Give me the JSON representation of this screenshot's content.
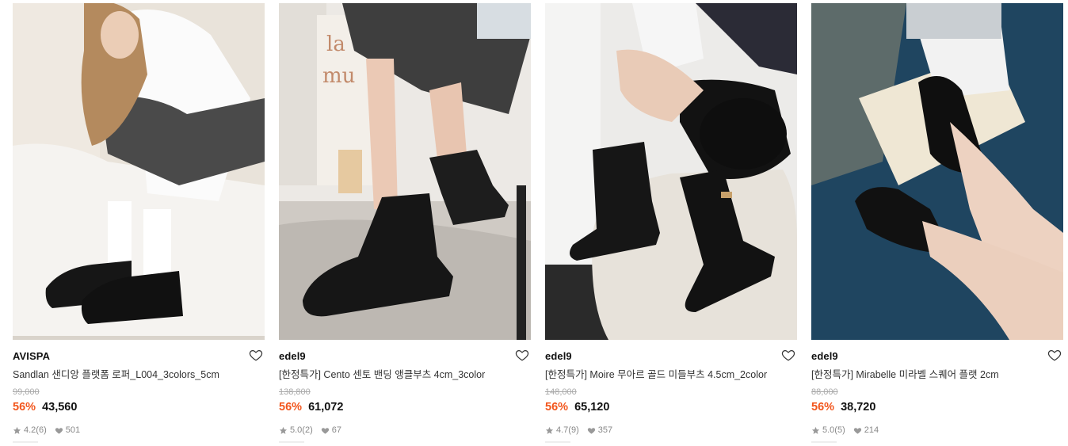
{
  "products": [
    {
      "brand": "AVISPA",
      "title": "Sandlan 샌디앙 플랫폼 로퍼_L004_3colors_5cm",
      "original_price": "99,000",
      "discount": "56%",
      "price": "43,560",
      "rating": "4.2",
      "review_count": "(6)",
      "likes": "501",
      "image_alt": "Black platform loafers with white socks"
    },
    {
      "brand": "edel9",
      "title": "[한정특가] Cento 센토 밴딩 앵클부츠 4cm_3color",
      "original_price": "138,800",
      "discount": "56%",
      "price": "61,072",
      "rating": "5.0",
      "review_count": "(2)",
      "likes": "67",
      "image_alt": "Black chelsea ankle boots"
    },
    {
      "brand": "edel9",
      "title": "[한정특가] Moire 무아르 골드 미들부츠 4.5cm_2color",
      "original_price": "148,000",
      "discount": "56%",
      "price": "65,120",
      "rating": "4.7",
      "review_count": "(9)",
      "likes": "357",
      "image_alt": "Black middle boots with gold detail"
    },
    {
      "brand": "edel9",
      "title": "[한정특가] Mirabelle 미라벨 스퀘어 플랫 2cm",
      "original_price": "88,000",
      "discount": "56%",
      "price": "38,720",
      "rating": "5.0",
      "review_count": "(5)",
      "likes": "214",
      "image_alt": "Black square-toe flats on blue carpet"
    }
  ],
  "colors": {
    "discount": "#f2561d",
    "text": "#222222",
    "muted": "#aaaaaa"
  },
  "icons": {
    "wishlist": "heart-outline-icon",
    "rating": "star-icon",
    "likes": "heart-filled-icon"
  }
}
